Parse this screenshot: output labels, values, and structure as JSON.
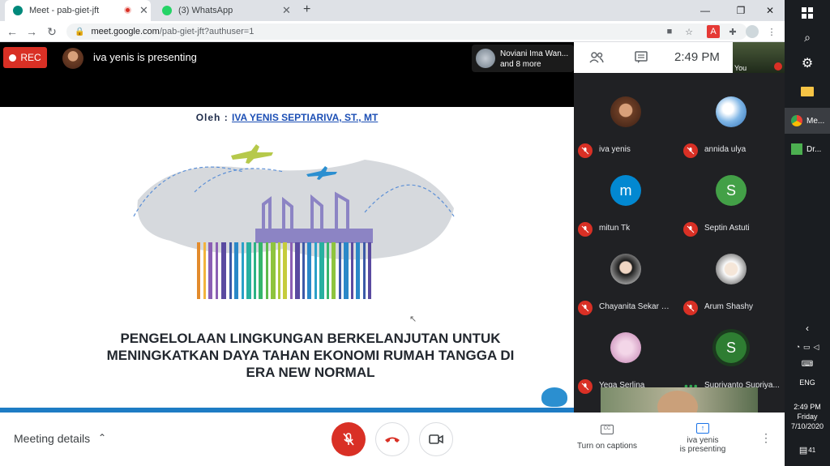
{
  "browser": {
    "tabs": [
      {
        "title": "Meet - pab-giet-jft",
        "active": true
      },
      {
        "title": "(3) WhatsApp",
        "active": false
      }
    ],
    "new_tab": "+",
    "url_host": "meet.google.com",
    "url_path": "/pab-giet-jft?authuser=1"
  },
  "meet": {
    "rec_label": "REC",
    "presenting_text": "iva yenis is presenting",
    "others_chip_line1": "Noviani Ima Wan...",
    "others_chip_line2": "and 8 more",
    "clock": "2:49  PM",
    "self_label": "You",
    "meeting_details": "Meeting details",
    "turn_on_captions": "Turn on captions",
    "presenting_btn_line1": "iva yenis",
    "presenting_btn_line2": "is presenting",
    "accent_red": "#d93025"
  },
  "slide": {
    "author_prefix": "Oleh : ",
    "author_name": "IVA YENIS SEPTIARIVA, ST., MT",
    "title_line1": "PENGELOLAAN LINGKUNGAN BERKELANJUTAN UNTUK",
    "title_line2": "MENINGKATKAN DAYA TAHAN EKONOMI RUMAH TANGGA DI",
    "title_line3": "ERA NEW NORMAL"
  },
  "participants": [
    {
      "name": "iva yenis",
      "initial": "",
      "avatar_color": "#6b3d25",
      "muted": true
    },
    {
      "name": "annida ulya",
      "initial": "",
      "avatar_color": "#2f6fb5",
      "muted": true
    },
    {
      "name": "mitun Tk",
      "initial": "m",
      "avatar_color": "#0288d1",
      "muted": true
    },
    {
      "name": "Septin Astuti",
      "initial": "S",
      "avatar_color": "#43a047",
      "muted": true
    },
    {
      "name": "Chayanita Sekar Wi...",
      "initial": "",
      "avatar_color": "#8d6e63",
      "muted": true
    },
    {
      "name": "Arum Shashy",
      "initial": "",
      "avatar_color": "#3e3e3e",
      "muted": true
    },
    {
      "name": "Yega Serlina",
      "initial": "",
      "avatar_color": "#d7a4c8",
      "muted": true
    },
    {
      "name": "Supriyanto Supriya...",
      "initial": "S",
      "avatar_color": "#2e7d32",
      "muted": false
    }
  ],
  "taskbar": {
    "items": [
      "Me...",
      "Dr..."
    ],
    "lang": "ENG",
    "time": "2:49 PM",
    "day": "Friday",
    "date": "7/10/2020",
    "notif_count": "41"
  }
}
